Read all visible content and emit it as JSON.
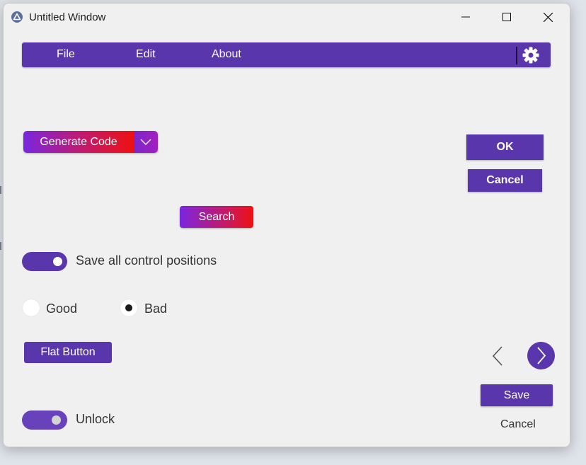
{
  "window": {
    "title": "Untitled Window"
  },
  "menubar": {
    "items": [
      "File",
      "Edit",
      "About"
    ]
  },
  "generate_button": {
    "label": "Generate Code"
  },
  "dialog_buttons": {
    "ok": "OK",
    "cancel": "Cancel"
  },
  "search_button": {
    "label": "Search"
  },
  "save_positions_toggle": {
    "label": "Save all control positions",
    "on": true
  },
  "radio_group": [
    {
      "label": "Good",
      "selected": false
    },
    {
      "label": "Bad",
      "selected": true
    }
  ],
  "flat_button": {
    "label": "Flat Button"
  },
  "bottom_actions": {
    "save": "Save",
    "cancel": "Cancel"
  },
  "unlock_toggle": {
    "label": "Unlock",
    "on": true
  },
  "colors": {
    "accent": "#5a36ad",
    "gradient_start": "#7a26e0",
    "gradient_end": "#ee1111"
  }
}
